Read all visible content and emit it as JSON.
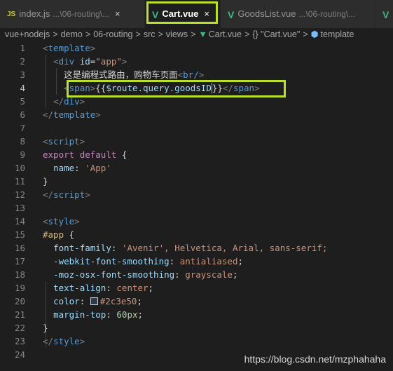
{
  "tabs": [
    {
      "icon": "JS",
      "name": "index.js",
      "path": "...\\06-routing\\...",
      "close": "×"
    },
    {
      "icon": "V",
      "name": "Cart.vue",
      "close": "×"
    },
    {
      "icon": "V",
      "name": "GoodsList.vue",
      "path": "...\\06-routing\\..."
    },
    {
      "icon": "V"
    }
  ],
  "breadcrumbs": [
    "vue+nodejs",
    "demo",
    "06-routing",
    "src",
    "views",
    "Cart.vue",
    "{} \"Cart.vue\"",
    "template"
  ],
  "breadcrumb_sep": ">",
  "editor": {
    "line_numbers": [
      "1",
      "2",
      "3",
      "4",
      "5",
      "6",
      "7",
      "8",
      "9",
      "10",
      "11",
      "12",
      "13",
      "14",
      "15",
      "16",
      "17",
      "18",
      "19",
      "20",
      "21",
      "22",
      "23",
      "24"
    ],
    "current_line": 4,
    "l1": {
      "open": "<",
      "tag": "template",
      "close": ">"
    },
    "l2": {
      "indent": "  ",
      "open": "<",
      "tag": "div",
      "attr": " id",
      "eq": "=",
      "val": "\"app\"",
      "close": ">"
    },
    "l3": {
      "indent": "    ",
      "text": "这是编程式路由，购物车页面",
      "open": "<",
      "tag": "br/",
      "close": ">"
    },
    "l4": {
      "indent": "    ",
      "open": "<",
      "tag": "span",
      "close": ">",
      "mustache_open": "{{",
      "expr": "$route.query.goodsID",
      "mustache_close": "}}",
      "endopen": "</",
      "endtag": "span",
      "endclose": ">"
    },
    "l5": {
      "indent": "  ",
      "open": "</",
      "tag": "div",
      "close": ">"
    },
    "l6": {
      "open": "</",
      "tag": "template",
      "close": ">"
    },
    "l8": {
      "open": "<",
      "tag": "script",
      "close": ">"
    },
    "l9": {
      "kw1": "export",
      "kw2": "default",
      "brace": "{"
    },
    "l10": {
      "prop": "name",
      "colon": ": ",
      "val": "'App'"
    },
    "l11": {
      "brace": "}"
    },
    "l12": {
      "open": "</",
      "tag": "script",
      "close": ">"
    },
    "l14": {
      "open": "<",
      "tag": "style",
      "close": ">"
    },
    "l15": {
      "sel": "#app",
      "brace": " {"
    },
    "l16": {
      "prop": "font-family",
      "colon": ": ",
      "v1": "'Avenir'",
      "rest": ", Helvetica, Arial, sans-serif;"
    },
    "l17": {
      "prop": "-webkit-font-smoothing",
      "colon": ": ",
      "val": "antialiased",
      "semi": ";"
    },
    "l18": {
      "prop": "-moz-osx-font-smoothing",
      "colon": ": ",
      "val": "grayscale",
      "semi": ";"
    },
    "l19": {
      "prop": "text-align",
      "colon": ": ",
      "val": "center",
      "semi": ";"
    },
    "l20": {
      "prop": "color",
      "colon": ": ",
      "val": "#2c3e50",
      "semi": ";",
      "swatch_color": "#2c3e50"
    },
    "l21": {
      "prop": "margin-top",
      "colon": ": ",
      "val": "60px",
      "semi": ";"
    },
    "l22": {
      "brace": "}"
    },
    "l23": {
      "open": "</",
      "tag": "style",
      "close": ">"
    }
  },
  "watermark": "https://blog.csdn.net/mzphahaha",
  "colors": {
    "highlight": "#b9e02c",
    "vue_icon": "#41b883",
    "js_icon": "#cbcb41"
  }
}
